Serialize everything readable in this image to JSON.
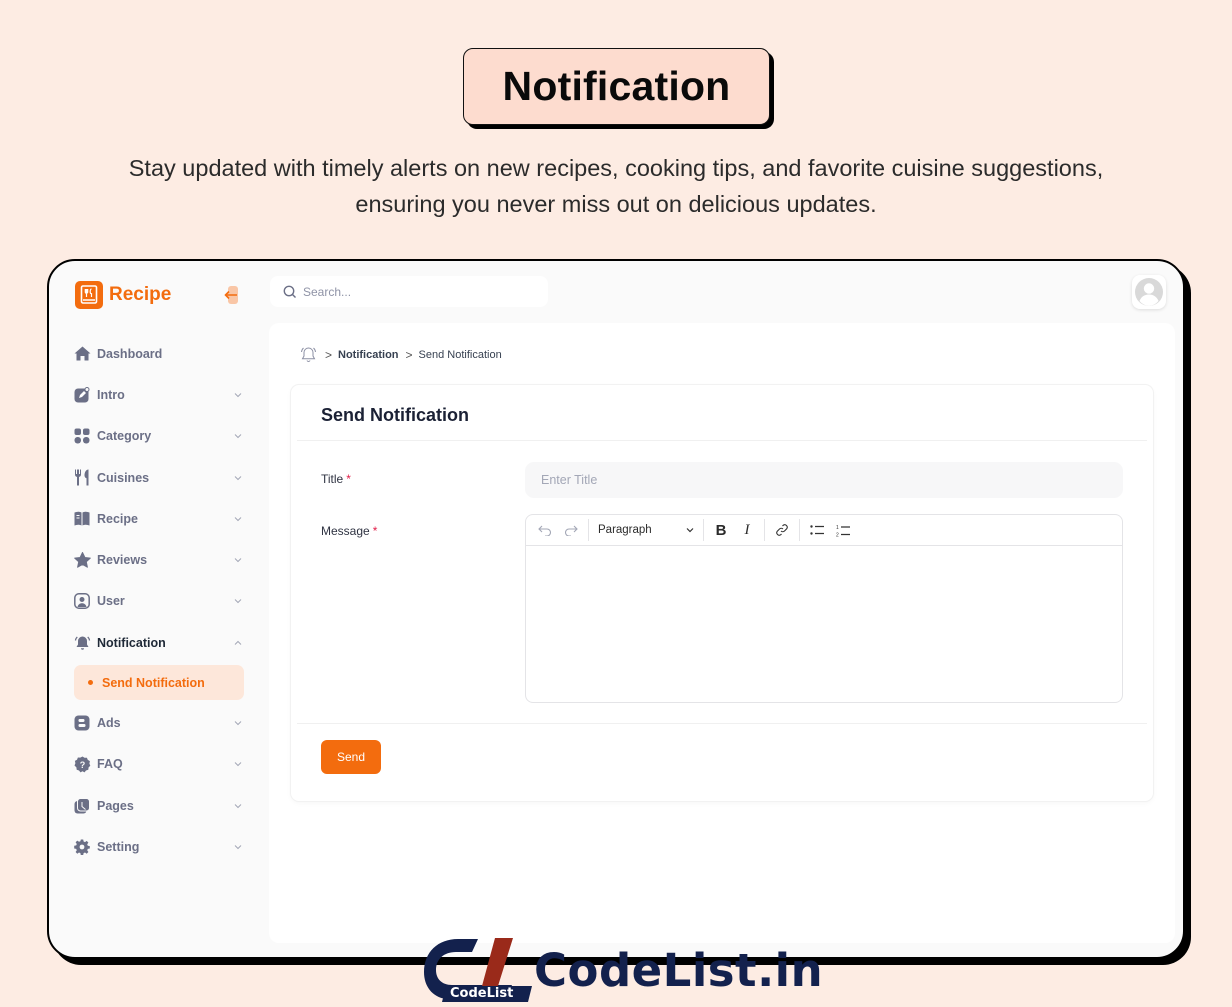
{
  "hero": {
    "title": "Notification",
    "subtitle": "Stay updated with timely alerts on new recipes, cooking tips, and favorite cuisine suggestions, ensuring you never miss out on delicious updates."
  },
  "brand": {
    "name": "Recipe",
    "accent": "#f36c0e"
  },
  "search": {
    "placeholder": "Search..."
  },
  "sidebar": {
    "items": [
      {
        "label": "Dashboard",
        "icon": "home-icon",
        "expandable": false
      },
      {
        "label": "Intro",
        "icon": "intro-icon",
        "expandable": true
      },
      {
        "label": "Category",
        "icon": "grid-icon",
        "expandable": true
      },
      {
        "label": "Cuisines",
        "icon": "fork-knife-icon",
        "expandable": true
      },
      {
        "label": "Recipe",
        "icon": "book-icon",
        "expandable": true
      },
      {
        "label": "Reviews",
        "icon": "star-icon",
        "expandable": true
      },
      {
        "label": "User",
        "icon": "user-icon",
        "expandable": true
      },
      {
        "label": "Notification",
        "icon": "bell-icon",
        "expandable": true,
        "expanded": true,
        "children": [
          {
            "label": "Send Notification",
            "active": true
          }
        ]
      },
      {
        "label": "Ads",
        "icon": "ads-icon",
        "expandable": true
      },
      {
        "label": "FAQ",
        "icon": "question-icon",
        "expandable": true
      },
      {
        "label": "Pages",
        "icon": "pages-icon",
        "expandable": true
      },
      {
        "label": "Setting",
        "icon": "gear-icon",
        "expandable": true
      }
    ]
  },
  "breadcrumb": {
    "items": [
      "Notification",
      "Send Notification"
    ],
    "icon": "bell-icon"
  },
  "form": {
    "title": "Send Notification",
    "title_label": "Title",
    "title_placeholder": "Enter Title",
    "title_value": "",
    "message_label": "Message",
    "required_mark": "*",
    "editor": {
      "block_format": "Paragraph",
      "tools": [
        "undo",
        "redo",
        "bold",
        "italic",
        "link",
        "bulleted-list",
        "numbered-list"
      ],
      "content": ""
    },
    "submit_label": "Send"
  },
  "watermark": {
    "badge": "CodeList",
    "text": "CodeList.in"
  }
}
